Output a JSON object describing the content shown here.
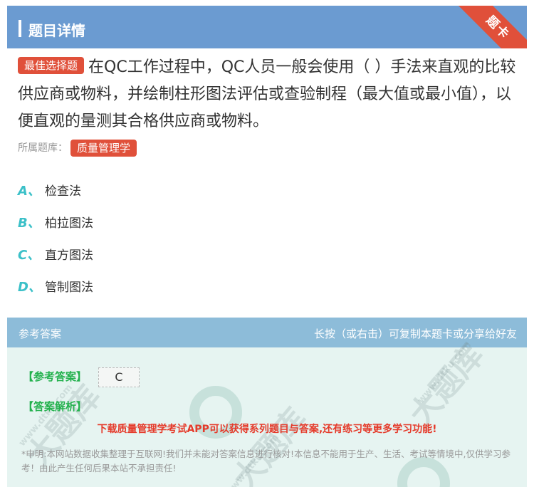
{
  "header": {
    "title": "题目详情",
    "ribbon": "题卡"
  },
  "question": {
    "tag": "最佳选择题",
    "text": "在QC工作过程中，QC人员一般会使用（ ）手法来直观的比较供应商或物料，并绘制柱形图法评估或查验制程（最大值或最小值），以便直观的量测其合格供应商或物料。"
  },
  "bank": {
    "label": "所属题库：",
    "name": "质量管理学"
  },
  "options": [
    {
      "letter": "A、",
      "text": "检查法"
    },
    {
      "letter": "B、",
      "text": "柏拉图法"
    },
    {
      "letter": "C、",
      "text": "直方图法"
    },
    {
      "letter": "D、",
      "text": "管制图法"
    }
  ],
  "answer": {
    "header_left": "参考答案",
    "header_right": "长按（或右击）可复制本题卡或分享给好友",
    "answer_label": "【参考答案】",
    "answer_value": "C",
    "analysis_label": "【答案解析】",
    "promo": "下载质量管理学考试APP可以获得系列题目与答案,还有练习等更多学习功能!",
    "disclaimer": "*申明:本网站数据收集整理于互联网!我们并未能对答案信息进行核对!本信息不能用于生产、生活、考试等情境中,仅供学习参考！由此产生任何后果本站不承担责任!"
  },
  "watermark": {
    "brand": "大题库",
    "url": "www.dtku.com"
  }
}
